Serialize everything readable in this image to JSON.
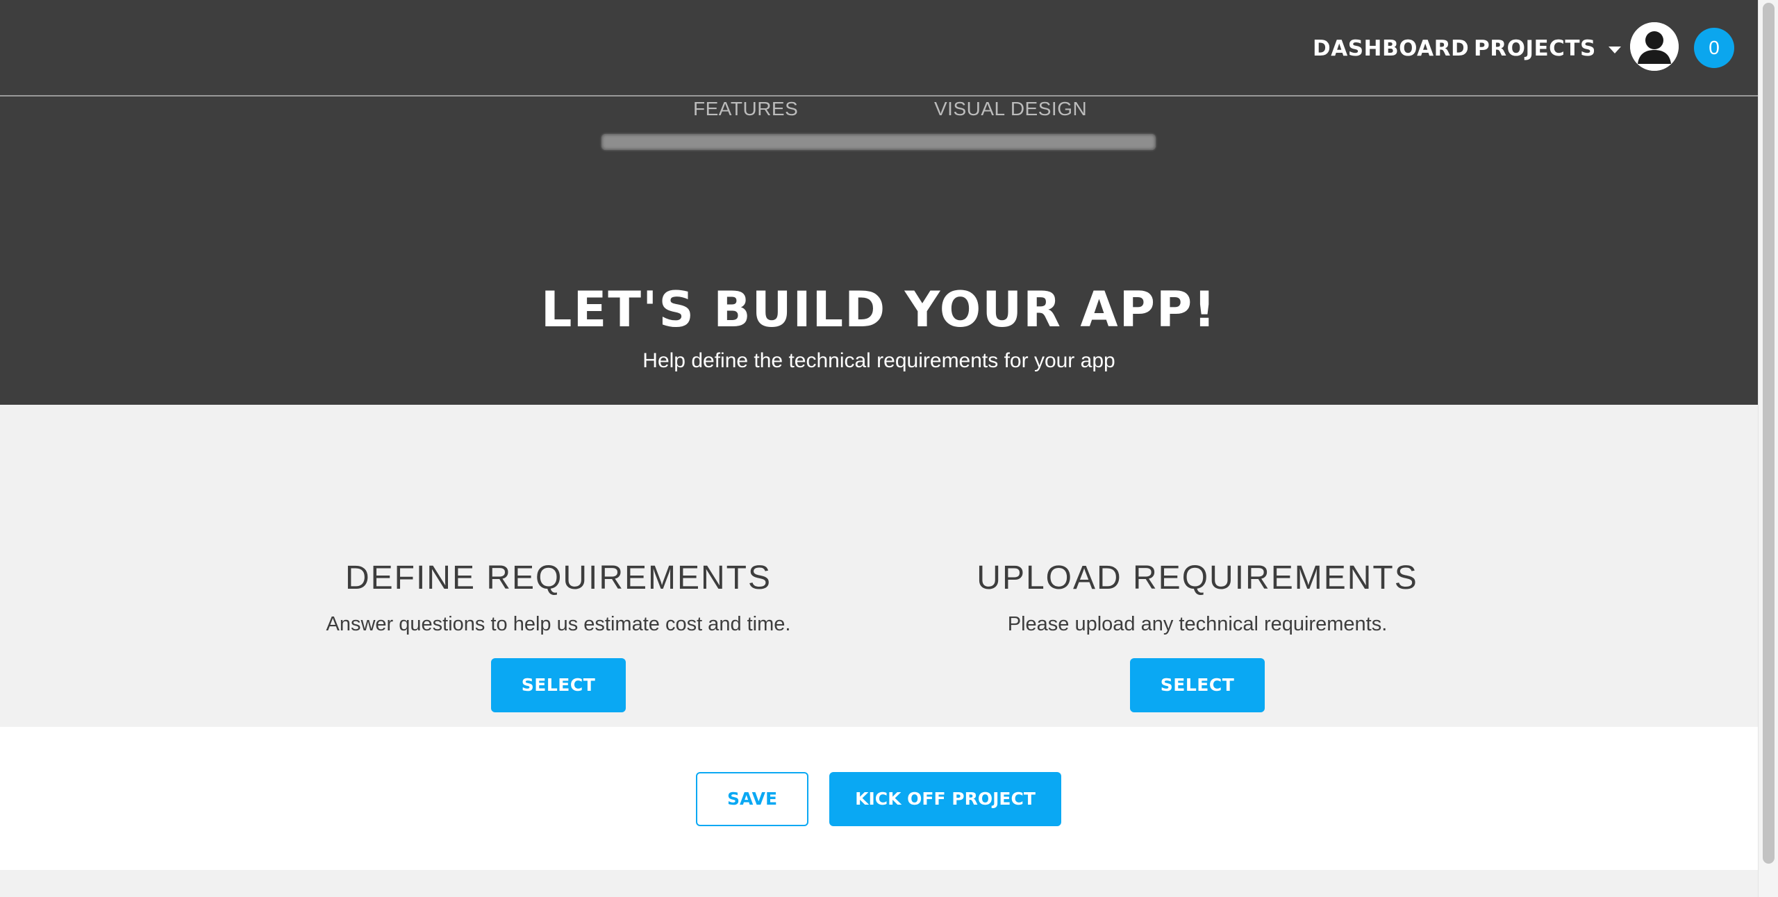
{
  "nav": {
    "dashboard": "DASHBOARD",
    "projects": "PROJECTS",
    "notification_count": "0",
    "avatar_icon": "user-avatar-icon",
    "caret_icon": "caret-down-icon"
  },
  "progress": {
    "steps": [
      "FEATURES",
      "VISUAL DESIGN"
    ],
    "fill_fraction": 0
  },
  "hero": {
    "title": "LET'S BUILD YOUR APP!",
    "subtitle": "Help define the technical requirements for your app"
  },
  "options": [
    {
      "title": "DEFINE REQUIREMENTS",
      "description": "Answer questions to help us estimate cost and time.",
      "button": "SELECT"
    },
    {
      "title": "UPLOAD REQUIREMENTS",
      "description": "Please upload any technical requirements.",
      "button": "SELECT"
    }
  ],
  "actions": {
    "save": "SAVE",
    "kickoff": "KICK OFF PROJECT"
  },
  "colors": {
    "header_bg": "#3e3e3e",
    "accent": "#0aa8f3",
    "section_bg": "#f1f1f1"
  }
}
